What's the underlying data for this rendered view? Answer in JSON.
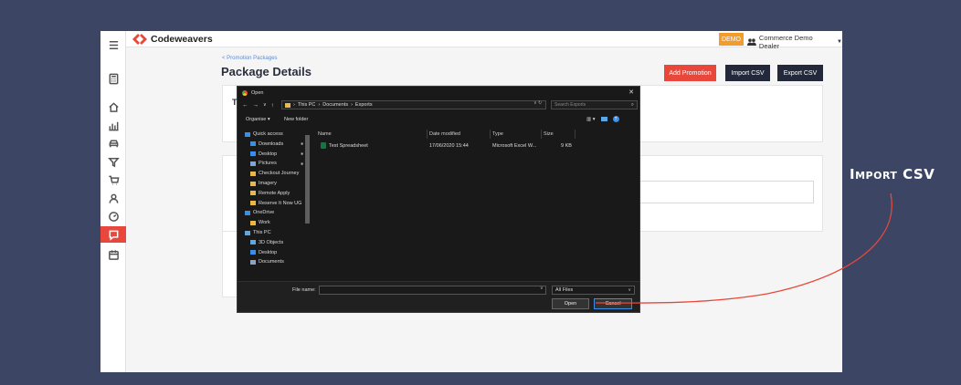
{
  "colors": {
    "background": "#3c4664",
    "accent_red": "#e8483b",
    "dark_button": "#23293a",
    "demo_orange": "#f39c2b",
    "link_blue": "#5b8dd6",
    "callout_line": "#e8483b"
  },
  "sidebar": {
    "items": [
      {
        "name": "hamburger-menu-icon"
      },
      {
        "name": "calculator-icon"
      },
      {
        "name": "home-icon"
      },
      {
        "name": "chart-icon"
      },
      {
        "name": "car-icon"
      },
      {
        "name": "filter-icon"
      },
      {
        "name": "cart-icon"
      },
      {
        "name": "user-icon"
      },
      {
        "name": "gauge-icon"
      },
      {
        "name": "promotion-icon",
        "active": true
      },
      {
        "name": "calendar-icon"
      }
    ]
  },
  "header": {
    "logo_text": "Codeweavers",
    "demo_badge": "DEMO",
    "user_name": "Commerce Demo Dealer"
  },
  "page": {
    "breadcrumb": "< Promotion Packages",
    "title": "Package Details",
    "card_partial_text": "T"
  },
  "actions": {
    "add_promotion": "Add Promotion",
    "import_csv": "Import CSV",
    "export_csv": "Export CSV"
  },
  "dialog": {
    "title": "Open",
    "path": [
      "This PC",
      "Documents",
      "Exports"
    ],
    "search_placeholder": "Search Exports",
    "organise_label": "Organise ▾",
    "new_folder_label": "New folder",
    "nav_items": [
      {
        "label": "Quick access",
        "icon": "star-icon",
        "color": "#3a8ee6"
      },
      {
        "label": "Downloads",
        "icon": "download-icon",
        "color": "#3a8ee6",
        "pinned": true
      },
      {
        "label": "Desktop",
        "icon": "desktop-icon",
        "color": "#3a8ee6",
        "pinned": true
      },
      {
        "label": "Pictures",
        "icon": "pictures-icon",
        "color": "#7aa6d8",
        "pinned": true
      },
      {
        "label": "Checkout Journey",
        "icon": "folder-icon",
        "color": "#e8b84a"
      },
      {
        "label": "Imagery",
        "icon": "folder-icon",
        "color": "#e8b84a"
      },
      {
        "label": "Remote Apply",
        "icon": "folder-icon",
        "color": "#e8b84a"
      },
      {
        "label": "Reserve It Now UG",
        "icon": "folder-icon",
        "color": "#e8b84a"
      },
      {
        "label": "OneDrive",
        "icon": "cloud-icon",
        "color": "#3a8ee6"
      },
      {
        "label": "Work",
        "icon": "folder-icon",
        "color": "#e8b84a"
      },
      {
        "label": "This PC",
        "icon": "computer-icon",
        "color": "#5aa9e6"
      },
      {
        "label": "3D Objects",
        "icon": "cube-icon",
        "color": "#5aa9e6"
      },
      {
        "label": "Desktop",
        "icon": "desktop-icon",
        "color": "#3a8ee6"
      },
      {
        "label": "Documents",
        "icon": "documents-icon",
        "color": "#8fa4c0"
      }
    ],
    "columns": [
      "Name",
      "Date modified",
      "Type",
      "Size"
    ],
    "files": [
      {
        "name": "Test Spreadsheet",
        "date": "17/06/2020 15:44",
        "type": "Microsoft Excel W...",
        "size": "9 KB"
      }
    ],
    "file_name_label": "File name:",
    "file_name_value": "",
    "filter_value": "All Files",
    "open_label": "Open",
    "cancel_label": "Cancel"
  },
  "annotation": {
    "callout_text": "Import CSV"
  }
}
